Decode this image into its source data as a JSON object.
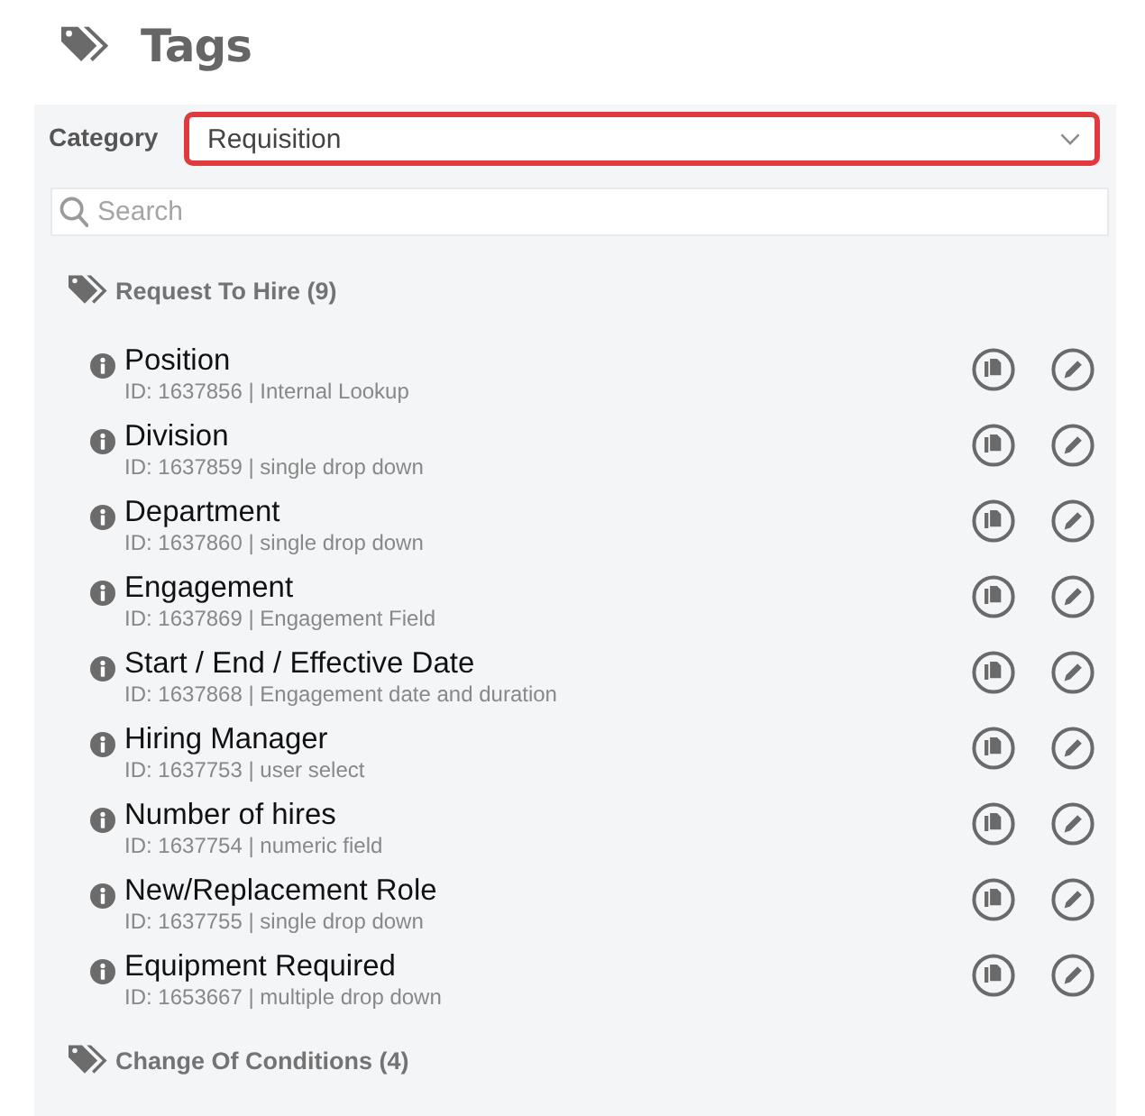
{
  "page": {
    "title": "Tags"
  },
  "filter": {
    "label": "Category",
    "value": "Requisition",
    "highlighted": true
  },
  "search": {
    "placeholder": "Search"
  },
  "groups": [
    {
      "title": "Request To Hire (9)",
      "items": [
        {
          "name": "Position",
          "detail": "ID: 1637856 | Internal Lookup"
        },
        {
          "name": "Division",
          "detail": "ID: 1637859 | single drop down"
        },
        {
          "name": "Department",
          "detail": "ID: 1637860 | single drop down"
        },
        {
          "name": "Engagement",
          "detail": "ID: 1637869 | Engagement Field"
        },
        {
          "name": "Start / End / Effective Date",
          "detail": "ID: 1637868 | Engagement date and duration"
        },
        {
          "name": "Hiring Manager",
          "detail": "ID: 1637753 | user select"
        },
        {
          "name": "Number of hires",
          "detail": "ID: 1637754 | numeric field"
        },
        {
          "name": "New/Replacement Role",
          "detail": "ID: 1637755 | single drop down"
        },
        {
          "name": "Equipment Required",
          "detail": "ID: 1653667 | multiple drop down"
        }
      ]
    },
    {
      "title": "Change Of Conditions (4)"
    }
  ]
}
